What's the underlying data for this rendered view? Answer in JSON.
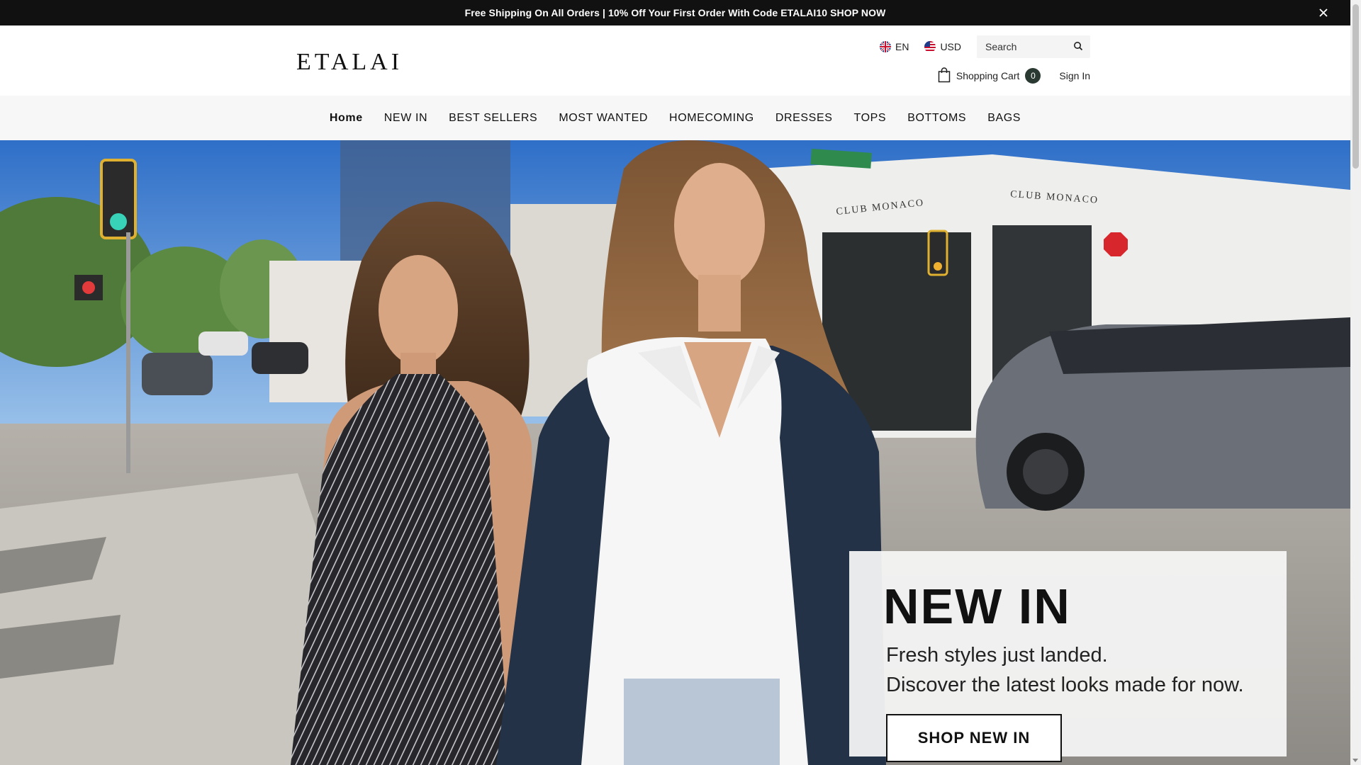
{
  "announcement": {
    "text": "Free Shipping On All Orders | 10% Off Your First Order With Code ETALAI10 SHOP NOW",
    "close_icon": "close-icon"
  },
  "header": {
    "logo": "ETALAI",
    "language": "EN",
    "currency": "USD",
    "search_placeholder": "Search",
    "cart_label": "Shopping Cart",
    "cart_count": "0",
    "sign_in": "Sign In"
  },
  "nav": {
    "items": [
      "Home",
      "NEW IN",
      "BEST SELLERS",
      "MOST WANTED",
      "HOMECOMING",
      "DRESSES",
      "TOPS",
      "BOTTOMS",
      "BAGS"
    ]
  },
  "hero": {
    "title": "NEW IN",
    "subtitle_line1": "Fresh styles just landed.",
    "subtitle_line2": "Discover the latest looks made for now.",
    "cta": "SHOP NEW IN",
    "image_alt": "hero-photo-two-models-street"
  },
  "colors": {
    "announcement_bg": "#111111",
    "nav_bg": "#f7f7f7",
    "badge_bg": "#2a3a32"
  }
}
